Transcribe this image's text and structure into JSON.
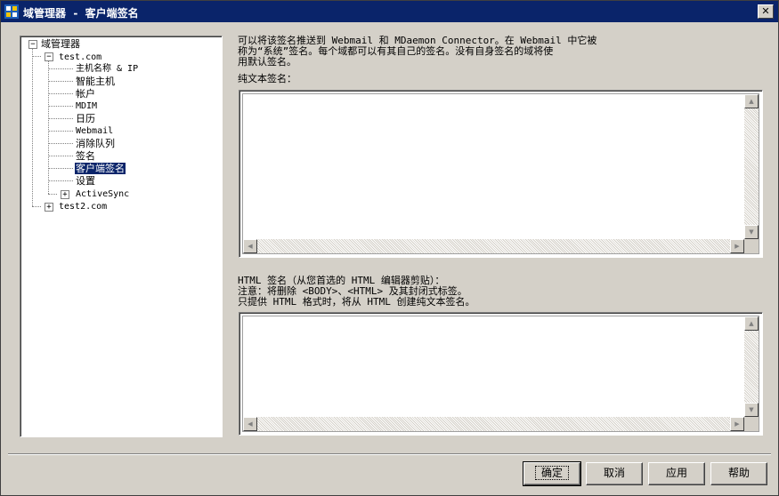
{
  "window": {
    "title": "域管理器 - 客户端签名",
    "close_glyph": "✕"
  },
  "tree": {
    "root": "域管理器",
    "domain1": "test.com",
    "children": [
      "主机名称 & IP",
      "智能主机",
      "帐户",
      "MDIM",
      "日历",
      "Webmail",
      "消除队列",
      "签名",
      "客户端签名",
      "设置",
      "ActiveSync"
    ],
    "selected": "客户端签名",
    "domain2": "test2.com",
    "collapse_glyph": "−",
    "expand_glyph": "+"
  },
  "description": [
    "可以将该签名推送到 Webmail 和 MDaemon Connector。在 Webmail 中它被",
    "称为“系统”签名。每个域都可以有其自己的签名。没有自身签名的域将使",
    "用默认签名。"
  ],
  "plain_text": {
    "label": "纯文本签名：",
    "value": ""
  },
  "html_sig": {
    "label_lines": [
      "HTML 签名（从您首选的 HTML 编辑器剪贴）：",
      "注意：将删除 <BODY>、<HTML> 及其封闭式标签。",
      "只提供 HTML 格式时，将从 HTML 创建纯文本签名。"
    ],
    "value": ""
  },
  "buttons": {
    "ok": "确定",
    "cancel": "取消",
    "apply": "应用",
    "help": "帮助"
  },
  "colors": {
    "titlebar": "#0a246a",
    "face": "#d4d0c8",
    "selection": "#0a246a"
  }
}
